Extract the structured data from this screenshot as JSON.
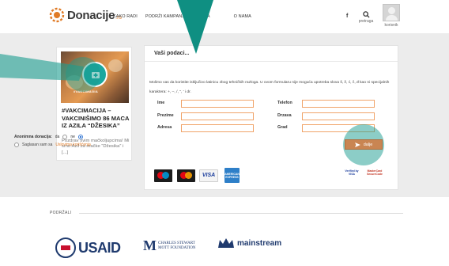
{
  "header": {
    "logo_text": "Donacije",
    "logo_tld": ".rs",
    "nav": [
      "KAKO RADI",
      "PODRŽI KAMPANJU",
      "ČESTA",
      "O NAMA"
    ],
    "fb_label": "f",
    "search_label": "pretraga",
    "user_label": "korisnik"
  },
  "campaign_card": {
    "badge_text": "#VAKCIMAGIA",
    "title": "#VAKCIMACIJA – VAKCINIŠIMO 86 MACA IZ AZILA “DŽESIKA”",
    "excerpt": "Pozdrav svim mačkoljupcima! Mi smo Azil za mačke “Džesika” i [...]"
  },
  "form": {
    "title": "Vaši podaci...",
    "intro": "Molimo vas da koristite isključivo latinicu zbog tehničkih razloga. U ovom formularu nije moguća upotreba slova š, ž, ć, č, đ kao ni specijalnih karaktera: +, –, /, \", ' i dr.",
    "labels": {
      "ime": "Ime",
      "telefon": "Telefon",
      "prezime": "Prezime",
      "drzava": "Drzava",
      "adresa": "Adresa",
      "grad": "Grad"
    },
    "anon_label": "Anonimna donacija:",
    "anon_yes": "da",
    "anon_no": "ne",
    "terms_text": "Saglasan sam sa",
    "terms_link": "Uslovima korišćenja",
    "submit_label": "dalje"
  },
  "payments": {
    "visa": "VISA",
    "amex": "AMERICAN EXPRESS",
    "verified": "Verified by VISA",
    "securecode": "MasterCard SecureCode"
  },
  "supporters": {
    "label": "PODRŽALI",
    "usaid": "USAID",
    "mott_line1": "CHARLES STEWART",
    "mott_line2": "MOTT FOUNDATION",
    "mainstream": "mainstream"
  },
  "colors": {
    "accent": "#e07b26",
    "field_border": "#f0a46a",
    "button": "#c98552",
    "overlay_teal": "#1a9c8f"
  },
  "icons": [
    "donacije-logo-icon",
    "facebook-icon",
    "search-icon",
    "user-avatar-icon",
    "vaccine-cross-icon",
    "send-icon"
  ]
}
